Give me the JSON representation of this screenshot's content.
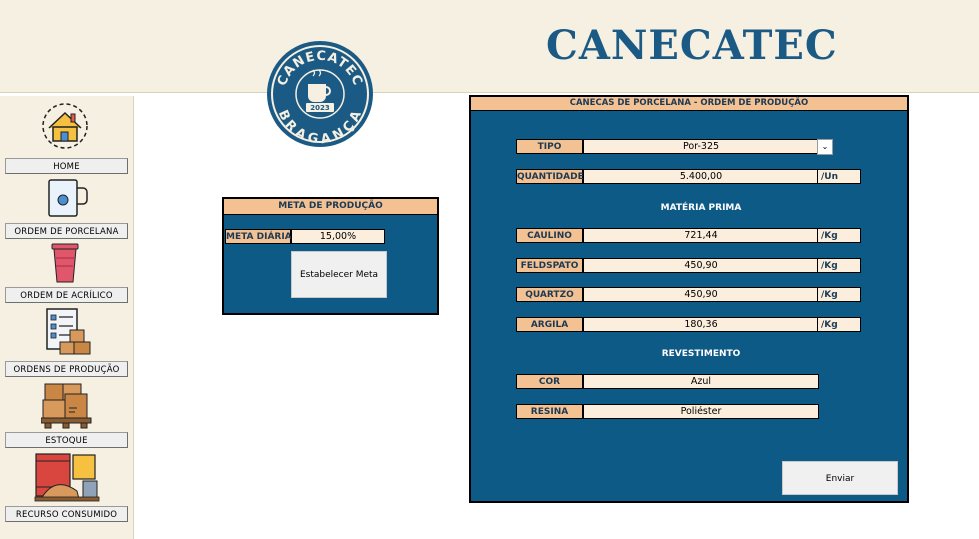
{
  "header": {
    "title": "CANECATEC"
  },
  "logo": {
    "top": "CANECATEC",
    "year": "2023",
    "bottom": "BRAGANÇA"
  },
  "sidebar": {
    "items": [
      {
        "label": "HOME",
        "icon": "home-icon"
      },
      {
        "label": "ORDEM DE PORCELANA",
        "icon": "porcelain-mug-icon"
      },
      {
        "label": "ORDEM DE ACRÍLICO",
        "icon": "acrylic-cup-icon"
      },
      {
        "label": "ORDENS DE PRODUÇÃO",
        "icon": "production-orders-icon"
      },
      {
        "label": "ESTOQUE",
        "icon": "stock-boxes-icon"
      },
      {
        "label": "RECURSO CONSUMIDO",
        "icon": "consumed-resource-icon"
      }
    ]
  },
  "meta": {
    "title": "META DE PRODUÇÃO",
    "daily_label": "META DIÁRIA",
    "daily_value": "15,00%",
    "button_label": "Estabelecer Meta"
  },
  "order": {
    "title": "CANECAS DE PORCELANA - ORDEM DE PRODUÇÃO",
    "tipo_label": "TIPO",
    "tipo_value": "Por-325",
    "quantidade_label": "QUANTIDADE",
    "quantidade_value": "5.400,00",
    "quantidade_unit": "/Un",
    "materia_title": "MATÉRIA PRIMA",
    "materials": [
      {
        "label": "CAULINO",
        "value": "721,44",
        "unit": "/Kg"
      },
      {
        "label": "FELDSPATO",
        "value": "450,90",
        "unit": "/Kg"
      },
      {
        "label": "QUARTZO",
        "value": "450,90",
        "unit": "/Kg"
      },
      {
        "label": "ARGILA",
        "value": "180,36",
        "unit": "/Kg"
      }
    ],
    "revestimento_title": "REVESTIMENTO",
    "cor_label": "COR",
    "cor_value": "Azul",
    "resina_label": "RESINA",
    "resina_value": "Poliéster",
    "submit_label": "Enviar"
  },
  "colors": {
    "panel_blue": "#0e5a86",
    "label_orange": "#f4c292",
    "value_cream": "#fbeedd",
    "title_blue": "#1c5a86",
    "sidebar_beige": "#f5f0e1"
  }
}
